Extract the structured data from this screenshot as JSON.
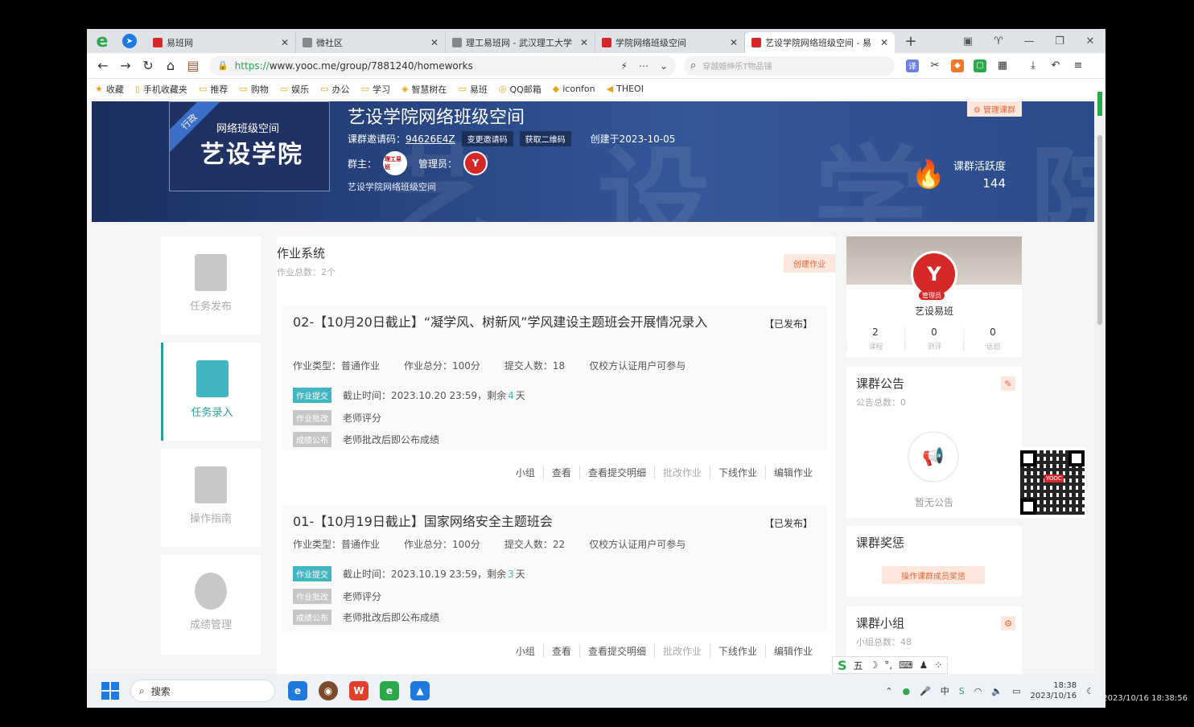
{
  "browser": {
    "tabs": [
      {
        "label": "易班网",
        "favicon_color": "#d62828",
        "active": false
      },
      {
        "label": "微社区",
        "favicon_color": "#888888",
        "active": false
      },
      {
        "label": "理工易班网 - 武汉理工大学",
        "favicon_color": "#888888",
        "active": false
      },
      {
        "label": "学院网络班级空间",
        "favicon_color": "#d62828",
        "active": false
      },
      {
        "label": "艺设学院网络班级空间 - 易",
        "favicon_color": "#d62828",
        "active": true
      }
    ],
    "url_scheme": "https://",
    "url_rest": "www.yooc.me/group/7881240/homeworks",
    "search_placeholder": "穿越婚绅乐T物品铺",
    "bookmarks": [
      "收藏",
      "手机收藏夹",
      "推荐",
      "购物",
      "娱乐",
      "办公",
      "学习",
      "智慧树在",
      "易班",
      "QQ邮箱",
      "iconfon",
      "THEOI"
    ]
  },
  "banner": {
    "logo_ribbon": "行政",
    "logo_sub": "网络班级空间",
    "logo_main": "艺设学院",
    "title": "艺设学院网络班级空间",
    "invite_label": "课群邀请码：",
    "invite_code": "94626E4Z",
    "change_code_btn": "变更邀请码",
    "qrcode_btn": "获取二维码",
    "created": "创建于2023-10-05",
    "owner_label": "群主：",
    "admin_label": "管理员：",
    "owner_avatar_text": "理工易班",
    "admin_avatar_text": "Y",
    "description": "艺设学院网络班级空间",
    "manage_btn": "管理课群",
    "activity_label": "课群活跃度",
    "activity_value": "144"
  },
  "left_nav": [
    {
      "label": "任务发布",
      "active": false
    },
    {
      "label": "任务录入",
      "active": true
    },
    {
      "label": "操作指南",
      "active": false
    },
    {
      "label": "成绩管理",
      "active": false
    }
  ],
  "main": {
    "title": "作业系统",
    "count": "作业总数：2个",
    "create_btn": "创建作业",
    "homeworks": [
      {
        "title": "02-【10月20日截止】“凝学风、树新风”学风建设主题班会开展情况录入",
        "status": "【已发布】",
        "type": "作业类型：普通作业",
        "score": "作业总分：100分",
        "submitted": "提交人数：18",
        "scope": "仅校方认证用户可参与",
        "submit_tag": "作业提交",
        "deadline": "截止时间：2023.10.20 23:59，剩余",
        "remain": "4",
        "remain_unit": "天",
        "review_tag": "作业批改",
        "review_text": "老师评分",
        "publish_tag": "成绩公布",
        "publish_text": "老师批改后即公布成绩"
      },
      {
        "title": "01-【10月19日截止】国家网络安全主题班会",
        "status": "【已发布】",
        "type": "作业类型：普通作业",
        "score": "作业总分：100分",
        "submitted": "提交人数：22",
        "scope": "仅校方认证用户可参与",
        "submit_tag": "作业提交",
        "deadline": "截止时间：2023.10.19 23:59，剩余",
        "remain": "3",
        "remain_unit": "天",
        "review_tag": "作业批改",
        "review_text": "老师评分",
        "publish_tag": "成绩公布",
        "publish_text": "老师批改后即公布成绩"
      }
    ],
    "actions": [
      "小组",
      "查看",
      "查看提交明细",
      "批改作业",
      "下线作业",
      "编辑作业"
    ]
  },
  "sidebar": {
    "profile_badge": "管理员",
    "profile_avatar_text": "Y",
    "profile_name": "艺设易班",
    "stats": [
      {
        "value": "2",
        "label": "课程"
      },
      {
        "value": "0",
        "label": "测评"
      },
      {
        "value": "0",
        "label": "话题"
      }
    ],
    "notice_title": "课群公告",
    "notice_count": "公告总数：0",
    "notice_empty": "暂无公告",
    "reward_title": "课群奖惩",
    "reward_btn": "操作课群成员奖惩",
    "group_title": "课群小组",
    "group_count": "小组总数：48"
  },
  "qr_center": "YOOC",
  "ime": [
    "五",
    "☽",
    "°,",
    "⌨",
    "♟",
    "⁘"
  ],
  "taskbar": {
    "search_label": "搜索",
    "time": "18:38",
    "date": "2023/10/16"
  },
  "recording_stamp": "2023/10/16 18:38:56"
}
